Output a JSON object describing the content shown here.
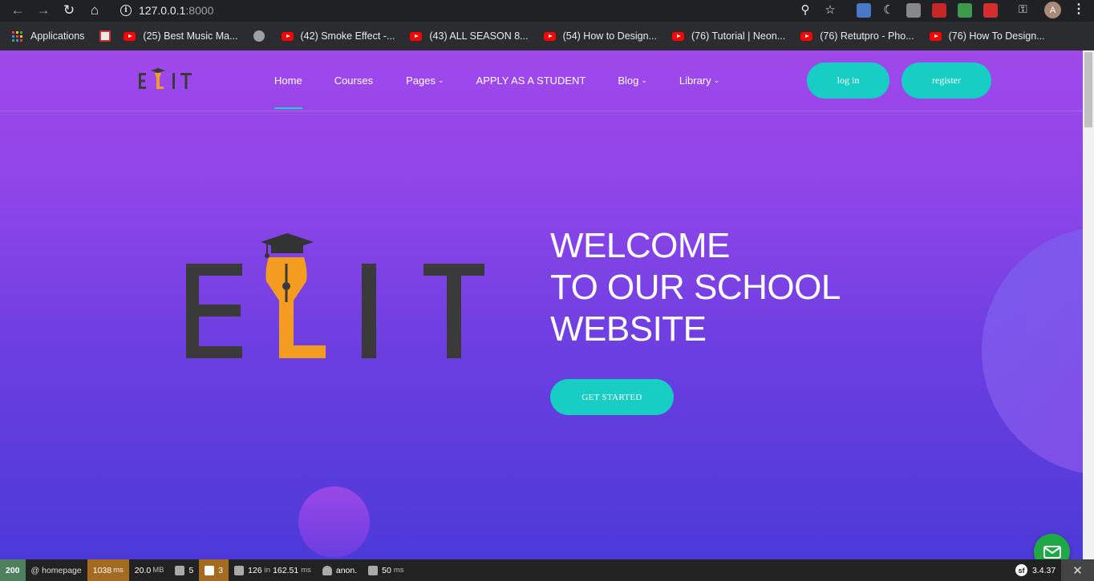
{
  "browser": {
    "url_host": "127.0.0.1",
    "url_port": ":8000",
    "profile_initial": "A",
    "bookmarks": [
      {
        "label": "Applications",
        "icon": "apps-grid-icon"
      },
      {
        "label": "",
        "icon": "bookmark-icon"
      },
      {
        "label": "(25) Best Music Ma...",
        "icon": "youtube-icon"
      },
      {
        "label": "",
        "icon": "globe-icon"
      },
      {
        "label": "(42) Smoke Effect -...",
        "icon": "youtube-icon"
      },
      {
        "label": "(43) ALL SEASON 8...",
        "icon": "youtube-icon"
      },
      {
        "label": "(54) How to Design...",
        "icon": "youtube-icon"
      },
      {
        "label": "(76) Tutorial | Neon...",
        "icon": "youtube-icon"
      },
      {
        "label": "(76) Retutpro - Pho...",
        "icon": "youtube-icon"
      },
      {
        "label": "(76) How To Design...",
        "icon": "youtube-icon"
      }
    ]
  },
  "site": {
    "logo_text": "ELIT",
    "nav": [
      {
        "label": "Home",
        "dropdown": false,
        "current": true
      },
      {
        "label": "Courses",
        "dropdown": false,
        "current": false
      },
      {
        "label": "Pages",
        "dropdown": true,
        "current": false
      },
      {
        "label": "APPLY AS A STUDENT",
        "dropdown": false,
        "current": false
      },
      {
        "label": "Blog",
        "dropdown": true,
        "current": false
      },
      {
        "label": "Library",
        "dropdown": true,
        "current": false
      }
    ],
    "login_label": "log in",
    "register_label": "register",
    "hero": {
      "line1": "WELCOME",
      "line2": "TO OUR SCHOOL",
      "line3": "WEBSITE",
      "cta_label": "GET STARTED"
    },
    "colors": {
      "accent": "#18cdc3",
      "logo_dark": "#3a3a3a",
      "logo_orange": "#f39c1f",
      "chat_green": "#1fa846"
    }
  },
  "debug_toolbar": {
    "status_code": "200",
    "route": "@ homepage",
    "time": "1038",
    "time_unit": "ms",
    "memory": "20.0",
    "memory_unit": "MB",
    "forms": "5",
    "warnings": "3",
    "queries": "126",
    "queries_in": "in",
    "queries_time": "162.51",
    "queries_unit": "ms",
    "user": "anon.",
    "render_time": "50",
    "render_unit": "ms",
    "version": "3.4.37"
  }
}
